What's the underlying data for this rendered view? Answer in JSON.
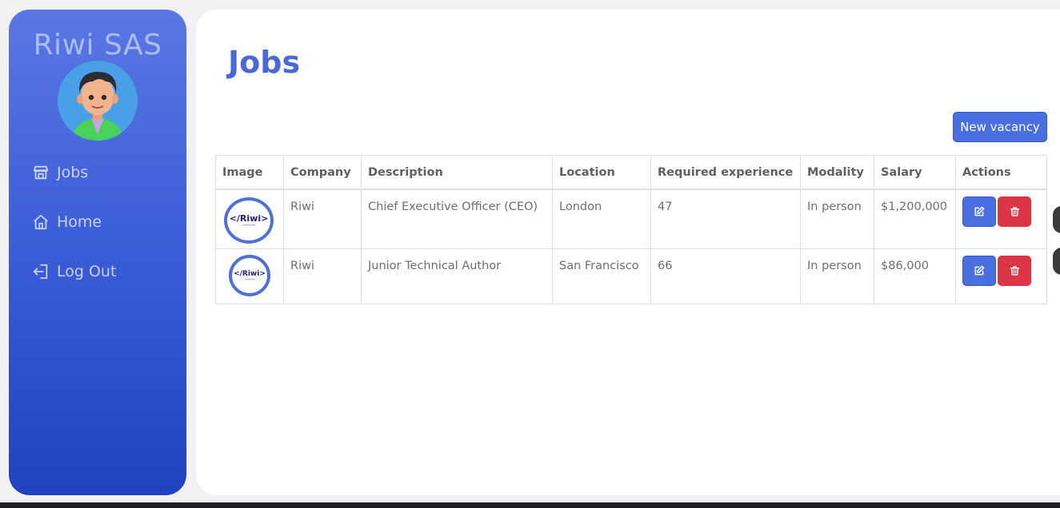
{
  "sidebar": {
    "brand": "Riwi SAS",
    "nav": [
      {
        "label": "Jobs",
        "icon": "store-icon"
      },
      {
        "label": "Home",
        "icon": "home-icon"
      },
      {
        "label": "Log Out",
        "icon": "logout-icon"
      }
    ]
  },
  "main": {
    "title": "Jobs",
    "new_button": "New vacancy",
    "table": {
      "headers": [
        "Image",
        "Company",
        "Description",
        "Location",
        "Required experience",
        "Modality",
        "Salary",
        "Actions"
      ],
      "rows": [
        {
          "logo": "</Riwi>",
          "company": "Riwi",
          "description": "Chief Executive Officer (CEO)",
          "location": "London",
          "experience": "47",
          "modality": "In person",
          "salary": "$1,200,000"
        },
        {
          "logo": "</Riwi>",
          "company": "Riwi",
          "description": "Junior Technical Author",
          "location": "San Francisco",
          "experience": "66",
          "modality": "In person",
          "salary": "$86,000"
        }
      ]
    }
  },
  "colors": {
    "accent": "#4a68d8",
    "danger": "#dc3545",
    "sidebar_top": "#5a77e3",
    "sidebar_bottom": "#2142c0"
  }
}
